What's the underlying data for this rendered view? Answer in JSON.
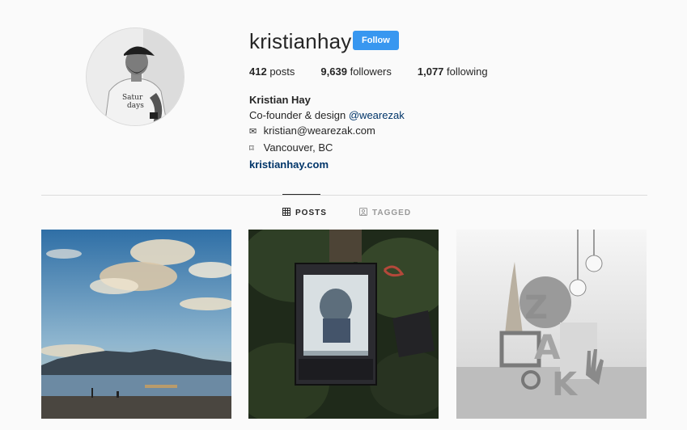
{
  "profile": {
    "username": "kristianhay",
    "follow_label": "Follow",
    "stats": {
      "posts_count": "412",
      "posts_label": "posts",
      "followers_count": "9,639",
      "followers_label": "followers",
      "following_count": "1,077",
      "following_label": "following"
    },
    "bio": {
      "full_name": "Kristian Hay",
      "line1_prefix": "Co-founder & design ",
      "line1_mention": "@wearezak",
      "email_icon": "✉",
      "email": "kristian@wearezak.com",
      "location_icon": "⌑",
      "location": "Vancouver, BC",
      "website": "kristianhay.com"
    }
  },
  "tabs": [
    {
      "label": "POSTS",
      "icon": "grid-icon",
      "active": true
    },
    {
      "label": "TAGGED",
      "icon": "tag-icon",
      "active": false
    }
  ],
  "posts": [
    {
      "subject": "beach-sky-photo"
    },
    {
      "subject": "mirror-in-grass-photo"
    },
    {
      "subject": "zak-3d-render-photo"
    }
  ],
  "colors": {
    "accent": "#3897f0",
    "link": "#003569",
    "background": "#fafafa",
    "divider": "#dbdbdb"
  }
}
